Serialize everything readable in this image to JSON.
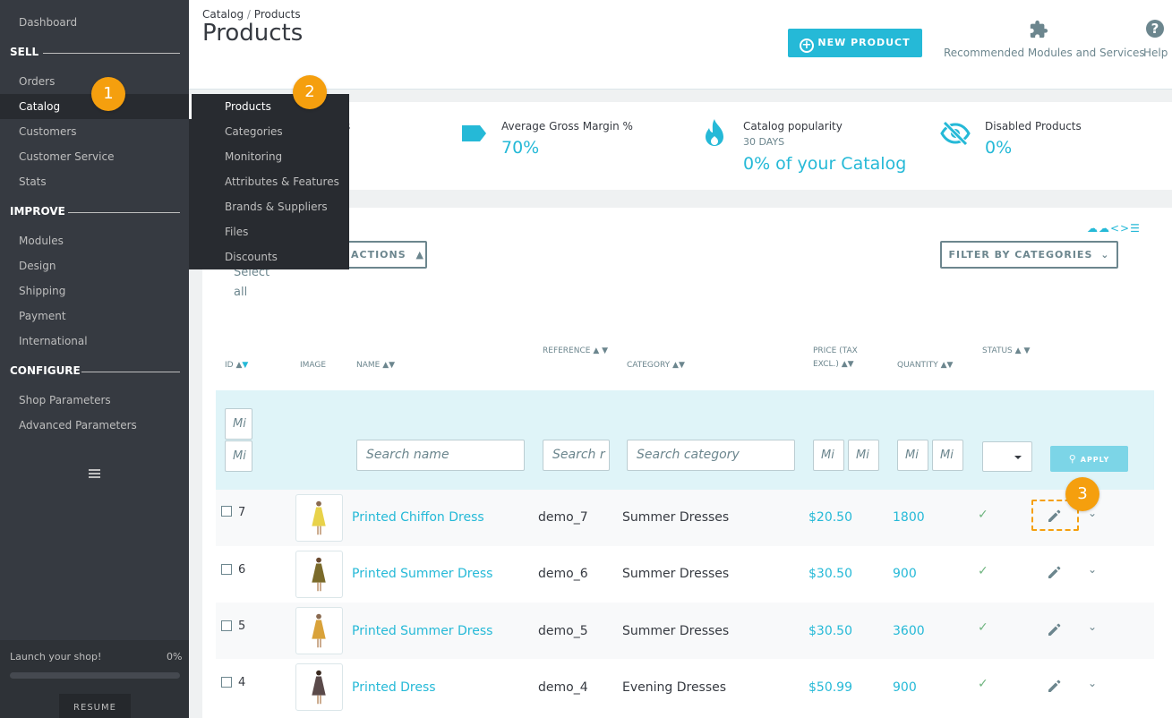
{
  "sidebar": {
    "dashboard": "Dashboard",
    "sections": {
      "sell": "SELL",
      "improve": "IMPROVE",
      "configure": "CONFIGURE"
    },
    "sell_items": [
      "Orders",
      "Catalog",
      "Customers",
      "Customer Service",
      "Stats"
    ],
    "improve_items": [
      "Modules",
      "Design",
      "Shipping",
      "Payment",
      "International"
    ],
    "configure_items": [
      "Shop Parameters",
      "Advanced Parameters"
    ],
    "launch_text": "Launch your shop!",
    "launch_pct": "0%",
    "launch_progress": 0,
    "resume_label": "RESUME"
  },
  "submenu": {
    "items": [
      "Products",
      "Categories",
      "Monitoring",
      "Attributes & Features",
      "Brands & Suppliers",
      "Files",
      "Discounts"
    ]
  },
  "callouts": [
    "1",
    "2",
    "3"
  ],
  "header": {
    "breadcrumb_parent": "Catalog",
    "breadcrumb_sep": "/",
    "breadcrumb_current": "Products",
    "title": "Products",
    "new_product_label": "NEW PRODUCT",
    "recommended_label": "Recommended Modules and Services",
    "help_label": "Help"
  },
  "kpis": {
    "partial_label": "s",
    "margin_label": "Average Gross Margin %",
    "margin_value": "70%",
    "popularity_label": "Catalog popularity",
    "popularity_sub": "30 DAYS",
    "popularity_value": "0% of your Catalog",
    "disabled_label": "Disabled Products",
    "disabled_value": "0%"
  },
  "toolbar": {
    "bulk_label": "ACTIONS",
    "filter_label": "FILTER BY CATEGORIES",
    "select_all": "Select all"
  },
  "columns": {
    "id": "ID",
    "image": "IMAGE",
    "name": "NAME",
    "reference": "REFERENCE",
    "category": "CATEGORY",
    "price": "PRICE (TAX EXCL.)",
    "quantity": "QUANTITY",
    "status": "STATUS"
  },
  "filters": {
    "id_min": "Mi",
    "id_max": "Mi",
    "name_placeholder": "Search name",
    "ref_placeholder": "Search r",
    "category_placeholder": "Search category",
    "price_min": "Mi",
    "price_max": "Mi",
    "qty_min": "Mi",
    "qty_max": "Mi",
    "apply_label": "APPLY"
  },
  "products": [
    {
      "id": "7",
      "name": "Printed Chiffon Dress",
      "reference": "demo_7",
      "category": "Summer Dresses",
      "price": "$20.50",
      "quantity": "1800",
      "dress_color": "#e8d24a"
    },
    {
      "id": "6",
      "name": "Printed Summer Dress",
      "reference": "demo_6",
      "category": "Summer Dresses",
      "price": "$30.50",
      "quantity": "900",
      "dress_color": "#7a6a2a"
    },
    {
      "id": "5",
      "name": "Printed Summer Dress",
      "reference": "demo_5",
      "category": "Summer Dresses",
      "price": "$30.50",
      "quantity": "3600",
      "dress_color": "#d9a23a"
    },
    {
      "id": "4",
      "name": "Printed Dress",
      "reference": "demo_4",
      "category": "Evening Dresses",
      "price": "$50.99",
      "quantity": "900",
      "dress_color": "#5a4a4a"
    }
  ],
  "colors": {
    "accent": "#25b9d7",
    "callout": "#f59f0e",
    "sidebar": "#363a41",
    "status_ok": "#70b580"
  }
}
